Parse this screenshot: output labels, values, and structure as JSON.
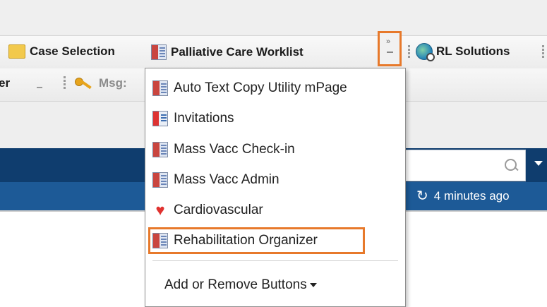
{
  "toolbar_row1": {
    "case_selection": "Case Selection",
    "palliative_worklist": "Palliative Care Worklist",
    "rl_solutions": "RL Solutions"
  },
  "toolbar_row2": {
    "partial_left": "er",
    "msg_label": "Msg:"
  },
  "overflow": {
    "chevron": "»"
  },
  "menu": {
    "items": [
      {
        "label": "Auto Text Copy Utility mPage",
        "icon": "mpage-icon"
      },
      {
        "label": "Invitations",
        "icon": "invitations-icon"
      },
      {
        "label": "Mass Vacc Check-in",
        "icon": "mpage-icon"
      },
      {
        "label": "Mass Vacc Admin",
        "icon": "mpage-icon"
      },
      {
        "label": "Cardiovascular",
        "icon": "heart-icon"
      },
      {
        "label": "Rehabilitation Organizer",
        "icon": "mpage-icon"
      }
    ],
    "add_remove": "Add or Remove Buttons"
  },
  "status": {
    "refresh_text": "4 minutes ago"
  },
  "colors": {
    "highlight": "#e7792b",
    "navy": "#0f3d6e",
    "blue": "#1d5a97"
  }
}
